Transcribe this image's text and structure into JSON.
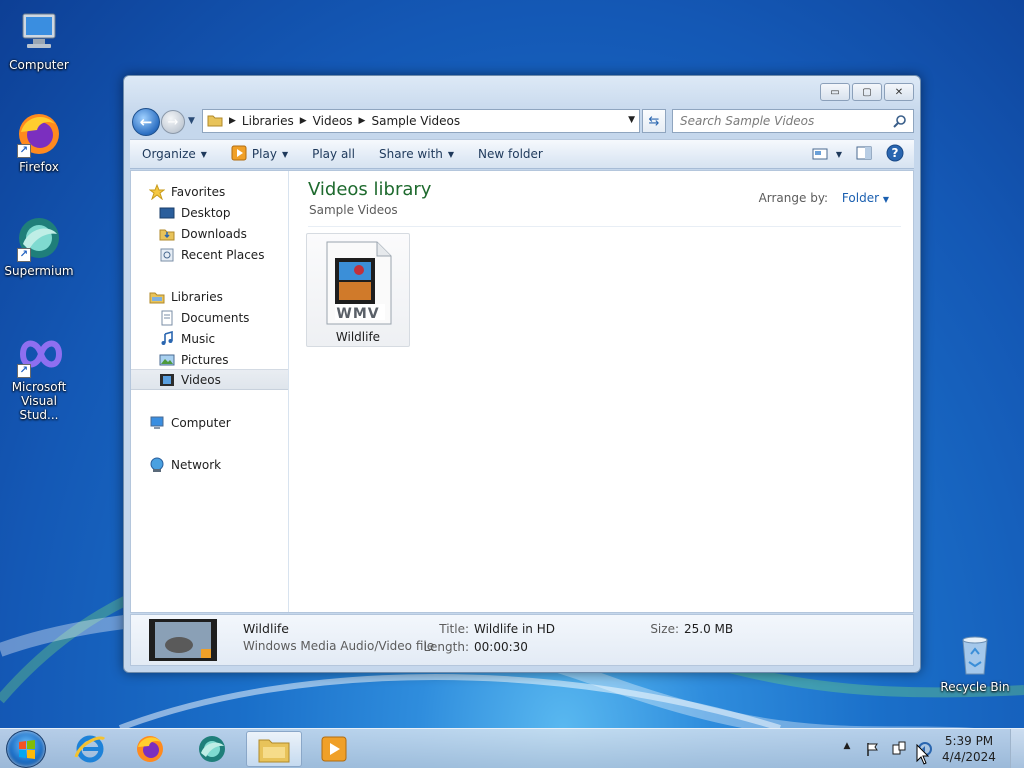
{
  "desktop": {
    "icons": [
      {
        "label": "Computer"
      },
      {
        "label": "Firefox"
      },
      {
        "label": "Supermium"
      },
      {
        "label": "Microsoft Visual Stud..."
      },
      {
        "label": "Recycle Bin"
      }
    ]
  },
  "window": {
    "controls": {
      "minimize": "▭",
      "maximize": "▢",
      "close": "✕"
    },
    "address": {
      "segments": [
        "Libraries",
        "Videos",
        "Sample Videos"
      ]
    },
    "search": {
      "placeholder": "Search Sample Videos"
    },
    "toolbar": {
      "organize": "Organize",
      "play": "Play",
      "play_all": "Play all",
      "share_with": "Share with",
      "new_folder": "New folder"
    },
    "nav": {
      "favorites": "Favorites",
      "desktop": "Desktop",
      "downloads": "Downloads",
      "recent_places": "Recent Places",
      "libraries": "Libraries",
      "documents": "Documents",
      "music": "Music",
      "pictures": "Pictures",
      "videos": "Videos",
      "computer": "Computer",
      "network": "Network",
      "selected": "Videos"
    },
    "main": {
      "title": "Videos library",
      "subtitle": "Sample Videos",
      "arrange_label": "Arrange by:",
      "arrange_value": "Folder",
      "files": [
        {
          "name": "Wildlife",
          "type_badge": "WMV"
        }
      ]
    },
    "details": {
      "name": "Wildlife",
      "type": "Windows Media Audio/Video file",
      "title_label": "Title:",
      "title_value": "Wildlife in HD",
      "length_label": "Length:",
      "length_value": "00:00:30",
      "size_label": "Size:",
      "size_value": "25.0 MB"
    }
  },
  "taskbar": {
    "apps": [
      "internet-explorer",
      "firefox",
      "supermium",
      "windows-explorer",
      "windows-media-player"
    ],
    "active_app": "windows-explorer",
    "clock": {
      "time": "5:39 PM",
      "date": "4/4/2024"
    }
  },
  "colors": {
    "library_title": "#1e6a2e",
    "link_blue": "#1a5fb0",
    "toolbar_text": "#1e395b"
  }
}
